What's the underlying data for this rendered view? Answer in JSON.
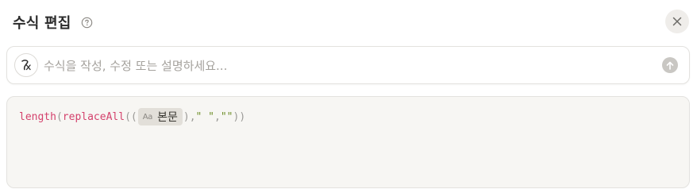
{
  "header": {
    "title": "수식 편집",
    "help_icon": "question-circle-icon",
    "close_icon": "close-x-icon"
  },
  "prompt": {
    "badge_glyph": "Σ",
    "placeholder": "수식을 작성, 수정 또는 설명하세요...",
    "value": "",
    "submit_icon": "arrow-up-icon"
  },
  "formula": {
    "fn_length": "length",
    "open_paren_1": "(",
    "fn_replace_all": "replaceAll",
    "open_paren_2": "((",
    "property": {
      "icon_text": "Aa",
      "name": "본문"
    },
    "after_prop": "),",
    "arg_space": "\" \"",
    "comma": ",",
    "arg_empty": "\"\"",
    "close": "))"
  },
  "colors": {
    "function": "#d4426d",
    "string": "#6f8f2a",
    "punctuation": "#9b9a97",
    "editor_bg": "#f7f6f3",
    "close_bg": "#efedea"
  }
}
